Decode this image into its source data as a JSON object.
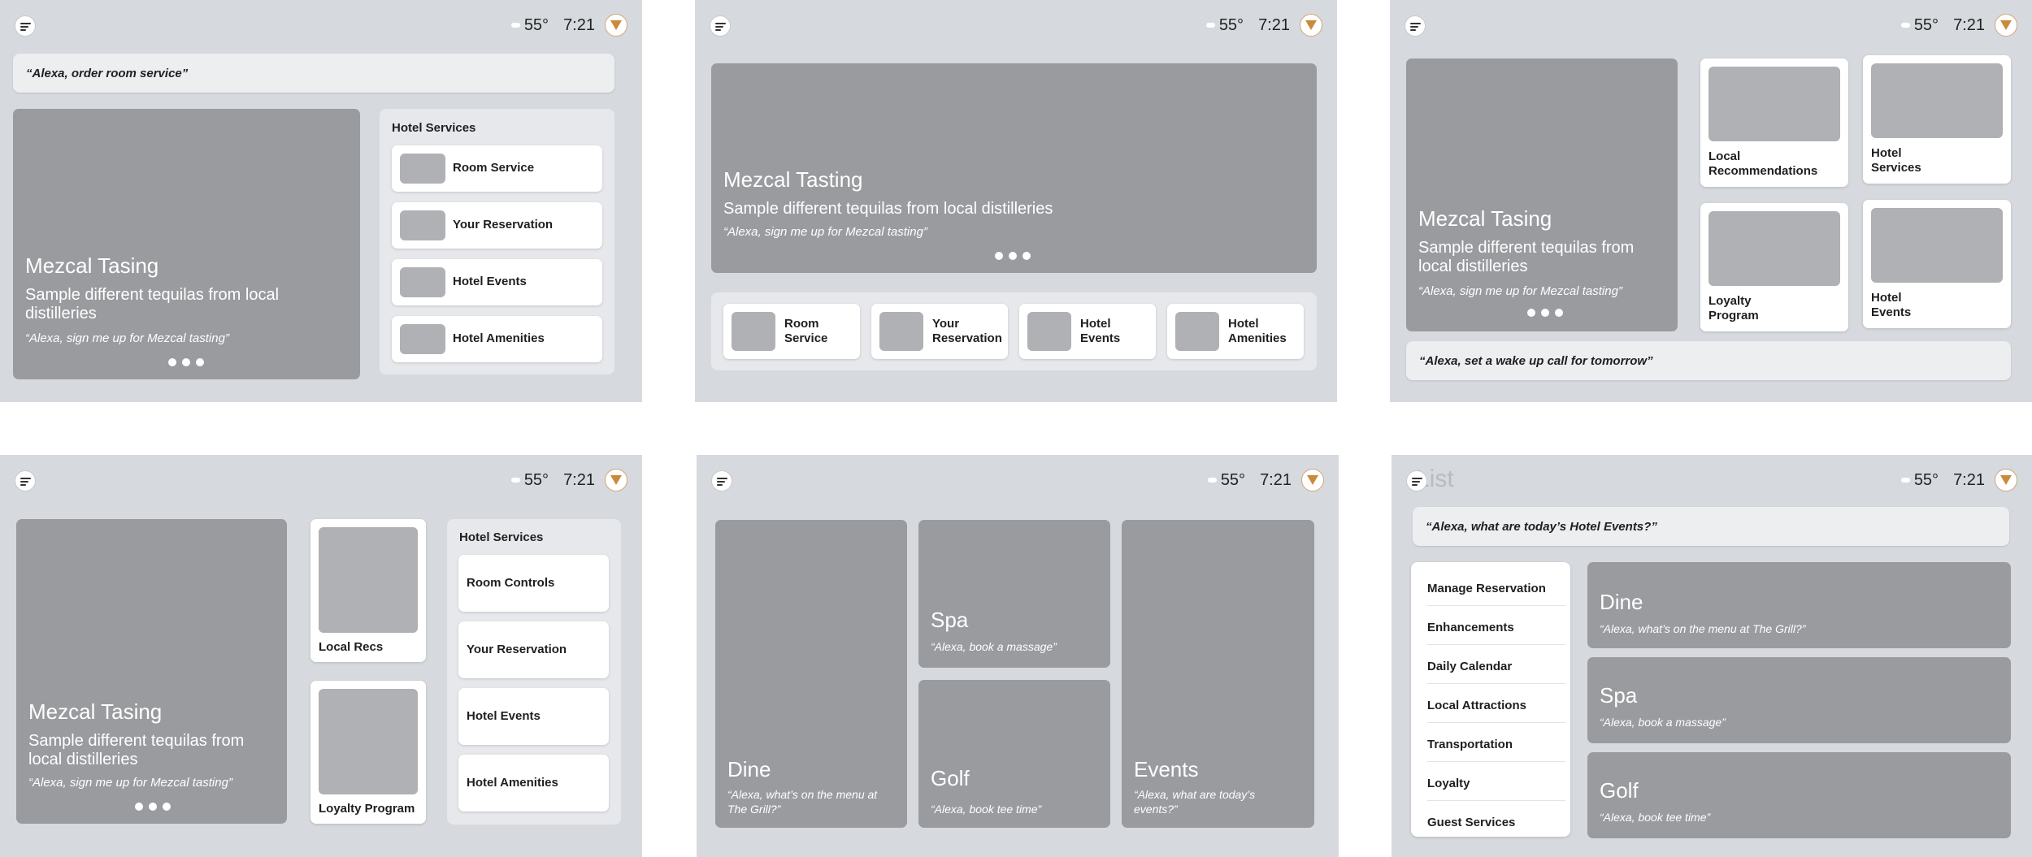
{
  "status": {
    "temperature": "55°",
    "time": "7:21"
  },
  "screen1": {
    "voice_prompt": "“Alexa, order room service”",
    "hero": {
      "title": "Mezcal Tasing",
      "subtitle": "Sample different tequilas from local distilleries",
      "prompt": "“Alexa, sign me up for Mezcal tasting”"
    },
    "panel_title": "Hotel Services",
    "services": [
      "Room Service",
      "Your Reservation",
      "Hotel Events",
      "Hotel Amenities"
    ]
  },
  "screen2": {
    "hero": {
      "title": "Mezcal Tasting",
      "subtitle": "Sample different tequilas from local distilleries",
      "prompt": "“Alexa, sign me up for Mezcal tasting”"
    },
    "services": [
      {
        "line1": "Room",
        "line2": "Service"
      },
      {
        "line1": "Your",
        "line2": "Reservation"
      },
      {
        "line1": "Hotel",
        "line2": "Events"
      },
      {
        "line1": "Hotel",
        "line2": "Amenities"
      }
    ]
  },
  "screen3": {
    "hero": {
      "title": "Mezcal Tasing",
      "subtitle_line1": "Sample different tequilas from",
      "subtitle_line2": "local distilleries",
      "prompt": "“Alexa, sign me up for Mezcal tasting”"
    },
    "cards": [
      {
        "line1": "Local",
        "line2": "Recommendations"
      },
      {
        "line1": "Hotel",
        "line2": "Services"
      },
      {
        "line1": "Loyalty",
        "line2": "Program"
      },
      {
        "line1": "Hotel",
        "line2": "Events"
      }
    ],
    "voice_prompt": "“Alexa, set a wake up call for tomorrow”"
  },
  "screen4": {
    "hero": {
      "title": "Mezcal Tasing",
      "subtitle_line1": "Sample different tequilas from",
      "subtitle_line2": "local distilleries",
      "prompt": "“Alexa, sign me up for Mezcal tasting”"
    },
    "cards": [
      "Local Recs",
      "Loyalty Program"
    ],
    "panel_title": "Hotel Services",
    "services": [
      "Room Controls",
      "Your Reservation",
      "Hotel Events",
      "Hotel Amenities"
    ]
  },
  "screen5": {
    "dine": {
      "title": "Dine",
      "prompt_line1": "“Alexa, what’s on the menu at",
      "prompt_line2": "The Grill?”"
    },
    "spa": {
      "title": "Spa",
      "prompt": "“Alexa, book a massage”"
    },
    "golf": {
      "title": "Golf",
      "prompt": "“Alexa, book tee time”"
    },
    "events": {
      "title": "Events",
      "prompt_line1": "“Alexa, what are today’s",
      "prompt_line2": "events?”"
    }
  },
  "screen6": {
    "ghost_title": "List",
    "voice_prompt": "“Alexa, what are today’s Hotel Events?”",
    "list_items": [
      "Manage Reservation",
      "Enhancements",
      "Daily Calendar",
      "Local Attractions",
      "Transportation",
      "Loyalty",
      "Guest Services"
    ],
    "tiles": [
      {
        "title": "Dine",
        "prompt": "“Alexa, what’s on the menu at The Grill?”"
      },
      {
        "title": "Spa",
        "prompt": "“Alexa, book a massage”"
      },
      {
        "title": "Golf",
        "prompt": "“Alexa, book tee time”"
      }
    ]
  }
}
